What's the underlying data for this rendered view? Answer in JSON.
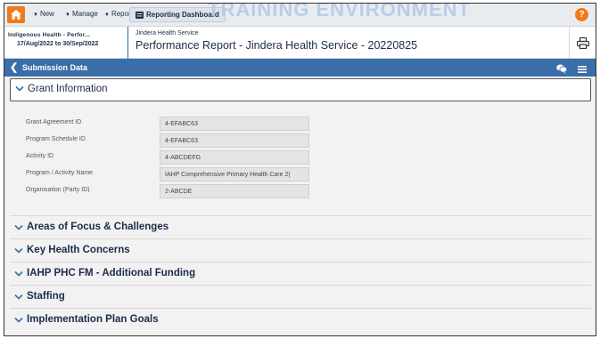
{
  "nav": {
    "new_label": "New",
    "manage_label": "Manage",
    "reports_label": "Reports",
    "dashboard_label": "Reporting Dashboard",
    "watermark": "TRAINING ENVIRONMENT"
  },
  "header": {
    "report_type": "Indigenous Health - Perfor...",
    "report_range": "17/Aug/2022 to 30/Sep/2022",
    "org_name": "Jindera Health Service",
    "report_title": "Performance Report - Jindera Health Service - 20220825"
  },
  "submission": {
    "title": "Submission Data"
  },
  "grant": {
    "section_label": "Grant Information",
    "fields": [
      {
        "label": "Grant Agreement ID",
        "value": "4-EFABC63"
      },
      {
        "label": "Program Schedule ID",
        "value": "4-EFABC63"
      },
      {
        "label": "Activity ID",
        "value": "4-ABCDEFG"
      },
      {
        "label": "Program / Activity Name",
        "value": "IAHP Comprehensive Primary Health Care 2("
      },
      {
        "label": "Organisation (Party ID)",
        "value": "2-ABCDE"
      }
    ]
  },
  "sections": [
    {
      "label": "Areas of Focus & Challenges"
    },
    {
      "label": "Key Health Concerns"
    },
    {
      "label": "IAHP PHC FM - Additional Funding"
    },
    {
      "label": "Staffing"
    },
    {
      "label": "Implementation Plan Goals"
    }
  ],
  "colors": {
    "accent_orange": "#f07a1a",
    "bar_blue": "#3a6ea8",
    "text_navy": "#1d2b4a"
  }
}
